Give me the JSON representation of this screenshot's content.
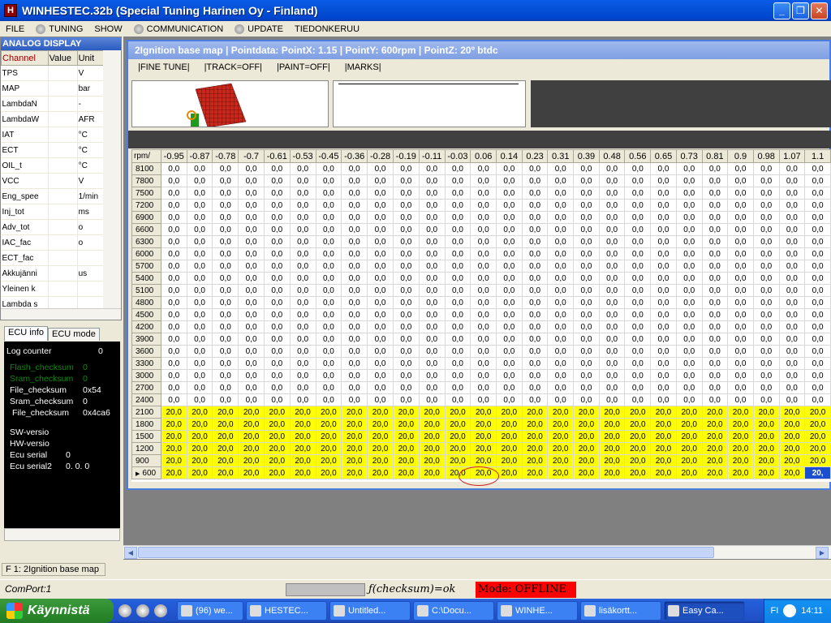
{
  "window": {
    "title": "WINHESTEC.32b (Special Tuning Harinen Oy - Finland)",
    "app_icon": "H",
    "buttons": {
      "minimize": "_",
      "maximize": "❐",
      "close": "✕"
    }
  },
  "menu": [
    "FILE",
    "TUNING",
    "SHOW",
    "COMMUNICATION",
    "UPDATE",
    "TIEDONKERUU"
  ],
  "analog": {
    "header": "ANALOG DISPLAY",
    "columns": [
      "Channel",
      "Value",
      "Unit"
    ],
    "rows": [
      {
        "channel": "TPS",
        "value": "",
        "unit": "V"
      },
      {
        "channel": "MAP",
        "value": "",
        "unit": "bar"
      },
      {
        "channel": "LambdaN",
        "value": "",
        "unit": "-"
      },
      {
        "channel": "LambdaW",
        "value": "",
        "unit": "AFR"
      },
      {
        "channel": "IAT",
        "value": "",
        "unit": "°C"
      },
      {
        "channel": "ECT",
        "value": "",
        "unit": "°C"
      },
      {
        "channel": "OIL_t",
        "value": "",
        "unit": "°C"
      },
      {
        "channel": "VCC",
        "value": "",
        "unit": "V"
      },
      {
        "channel": "Eng_spee",
        "value": "",
        "unit": "1/min"
      },
      {
        "channel": "Inj_tot",
        "value": "",
        "unit": "ms"
      },
      {
        "channel": "Adv_tot",
        "value": "",
        "unit": "o"
      },
      {
        "channel": "IAC_fac",
        "value": "",
        "unit": "o"
      },
      {
        "channel": "ECT_fac",
        "value": "",
        "unit": ""
      },
      {
        "channel": "Akkujänni",
        "value": "",
        "unit": "us"
      },
      {
        "channel": "Yleinen k",
        "value": "",
        "unit": ""
      },
      {
        "channel": "Lambda s",
        "value": "",
        "unit": ""
      }
    ]
  },
  "ecu": {
    "tabs": [
      "ECU info",
      "ECU mode"
    ],
    "lines": [
      {
        "label": "Log counter",
        "value": "0",
        "green": false
      },
      {
        "label": "Flash_checksum",
        "value": "0",
        "green": true
      },
      {
        "label": "Sram_checksum",
        "value": "0",
        "green": true
      },
      {
        "label": "File_checksum",
        "value": "0x54",
        "green": false
      },
      {
        "label": "Sram_checksum",
        "value": "0",
        "green": false
      },
      {
        "label": "File_checksum",
        "value": "0x4ca6",
        "green": false
      },
      {
        "label": "SW-versio",
        "value": "",
        "green": false
      },
      {
        "label": "HW-versio",
        "value": "",
        "green": false
      },
      {
        "label": "Ecu serial",
        "value": "0",
        "green": false
      },
      {
        "label": "Ecu serial2",
        "value": "0. 0. 0",
        "green": false
      }
    ]
  },
  "map": {
    "title": "2Ignition base map | Pointdata: PointX: 1.15 | PointY: 600rpm | PointZ: 20º btdc",
    "toolbar": [
      "|FINE TUNE|",
      "|TRACK=OFF|",
      "|PAINT=OFF|",
      "|MARKS|"
    ],
    "corner": "rpm/",
    "columns": [
      "-0.95",
      "-0.87",
      "-0.78",
      "-0.7",
      "-0.61",
      "-0.53",
      "-0.45",
      "-0.36",
      "-0.28",
      "-0.19",
      "-0.11",
      "-0.03",
      "0.06",
      "0.14",
      "0.23",
      "0.31",
      "0.39",
      "0.48",
      "0.56",
      "0.65",
      "0.73",
      "0.81",
      "0.9",
      "0.98",
      "1.07",
      "1.1"
    ],
    "rows": [
      {
        "rpm": "8100",
        "value": "0,0",
        "hi": false
      },
      {
        "rpm": "7800",
        "value": "0,0",
        "hi": false
      },
      {
        "rpm": "7500",
        "value": "0,0",
        "hi": false
      },
      {
        "rpm": "7200",
        "value": "0,0",
        "hi": false
      },
      {
        "rpm": "6900",
        "value": "0,0",
        "hi": false
      },
      {
        "rpm": "6600",
        "value": "0,0",
        "hi": false
      },
      {
        "rpm": "6300",
        "value": "0,0",
        "hi": false
      },
      {
        "rpm": "6000",
        "value": "0,0",
        "hi": false
      },
      {
        "rpm": "5700",
        "value": "0,0",
        "hi": false
      },
      {
        "rpm": "5400",
        "value": "0,0",
        "hi": false
      },
      {
        "rpm": "5100",
        "value": "0,0",
        "hi": false
      },
      {
        "rpm": "4800",
        "value": "0,0",
        "hi": false
      },
      {
        "rpm": "4500",
        "value": "0,0",
        "hi": false
      },
      {
        "rpm": "4200",
        "value": "0,0",
        "hi": false
      },
      {
        "rpm": "3900",
        "value": "0,0",
        "hi": false
      },
      {
        "rpm": "3600",
        "value": "0,0",
        "hi": false
      },
      {
        "rpm": "3300",
        "value": "0,0",
        "hi": false
      },
      {
        "rpm": "3000",
        "value": "0,0",
        "hi": false
      },
      {
        "rpm": "2700",
        "value": "0,0",
        "hi": false
      },
      {
        "rpm": "2400",
        "value": "0,0",
        "hi": false
      },
      {
        "rpm": "2100",
        "value": "20,0",
        "hi": true
      },
      {
        "rpm": "1800",
        "value": "20,0",
        "hi": true
      },
      {
        "rpm": "1500",
        "value": "20,0",
        "hi": true
      },
      {
        "rpm": "1200",
        "value": "20,0",
        "hi": true
      },
      {
        "rpm": "900",
        "value": "20,0",
        "hi": true
      },
      {
        "rpm": "600",
        "value": "20,0",
        "hi": true,
        "current": true
      }
    ],
    "selected_value": "20,",
    "current_marker": "▶"
  },
  "status": {
    "function": "F 1:   2Ignition base map",
    "comport": "ComPort:1",
    "checksum": "ƒ(checksum)=ok",
    "mode": "Mode: OFFLINE"
  },
  "taskbar": {
    "start": "Käynnistä",
    "tasks": [
      {
        "label": "(96) we...",
        "active": false
      },
      {
        "label": "HESTEC...",
        "active": false
      },
      {
        "label": "Untitled...",
        "active": false
      },
      {
        "label": "C:\\Docu...",
        "active": false
      },
      {
        "label": "WINHE...",
        "active": false
      },
      {
        "label": "lisäkortt...",
        "active": false
      },
      {
        "label": "Easy Ca...",
        "active": true
      }
    ],
    "lang": "FI",
    "clock": "14:11"
  }
}
